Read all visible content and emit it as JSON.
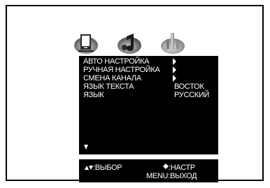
{
  "icons": [
    {
      "name": "tv-picture-icon"
    },
    {
      "name": "sound-note-icon"
    },
    {
      "name": "settings-tools-icon"
    }
  ],
  "menu": {
    "items": [
      {
        "label": "АВТО НАСТРОЙКА",
        "has_arrow": true,
        "value": ""
      },
      {
        "label": "РУЧНАЯ НАСТРОЙКА",
        "has_arrow": true,
        "value": ""
      },
      {
        "label": "СМЕНА КАНАЛА",
        "has_arrow": true,
        "value": ""
      },
      {
        "label": "ЯЗЫК ТЕКСТА",
        "has_arrow": false,
        "value": "ВОСТОК"
      },
      {
        "label": "ЯЗЫК",
        "has_arrow": false,
        "value": "РУССКИЙ"
      }
    ]
  },
  "help": {
    "select_label": ":ВЫБОР",
    "adjust_label": ":НАСТР",
    "exit_label": "MENU:ВЫХОД"
  },
  "colors": {
    "background": "#ffffff",
    "panel": "#000000",
    "text": "#ffffff"
  }
}
